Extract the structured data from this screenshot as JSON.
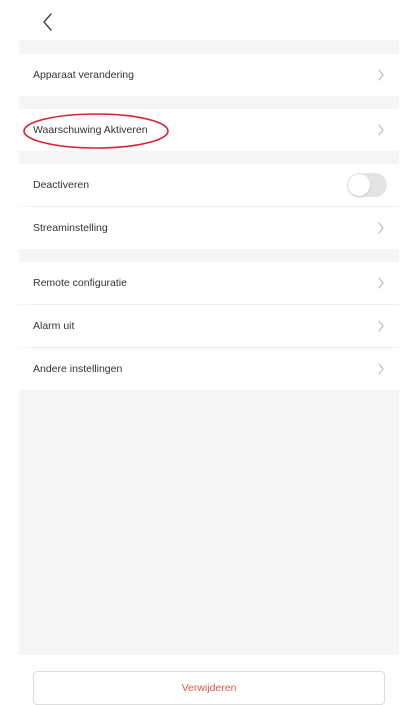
{
  "header": {
    "back_icon": "chevron-left-icon"
  },
  "settings": {
    "items": [
      {
        "label": "Apparaat verandering",
        "type": "link",
        "icon": "chevron-right-icon"
      },
      {
        "label": "Waarschuwing Aktiveren",
        "type": "link",
        "icon": "chevron-right-icon",
        "highlighted": true
      },
      {
        "label": "Deactiveren",
        "type": "toggle",
        "toggle_on": false
      },
      {
        "label": "Streaminstelling",
        "type": "link",
        "icon": "chevron-right-icon"
      },
      {
        "label": "Remote configuratie",
        "type": "link",
        "icon": "chevron-right-icon"
      },
      {
        "label": "Alarm uit",
        "type": "link",
        "icon": "chevron-right-icon"
      },
      {
        "label": "Andere instellingen",
        "type": "link",
        "icon": "chevron-right-icon"
      }
    ]
  },
  "footer": {
    "delete_label": "Verwijderen"
  },
  "colors": {
    "background_panel": "#f5f5f5",
    "delete_text": "#e05a47",
    "highlight_ring": "#d9232e",
    "chevron": "#bbbbbb"
  }
}
